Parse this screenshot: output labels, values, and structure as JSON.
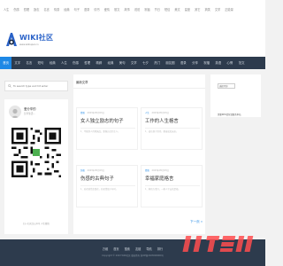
{
  "topbar": {
    "links": [
      "人生",
      "伤感",
      "哲理",
      "励志",
      "名言",
      "情感",
      "经典",
      "句子",
      "语录",
      "情书",
      "爱情",
      "散文",
      "故事",
      "说说",
      "祝福",
      "节日",
      "短信",
      "美文",
      "星座",
      "其它",
      "搞笑",
      "文学",
      "正能量"
    ]
  },
  "brand": {
    "logo_text": "WIKI社区",
    "tagline": "www.wikiuper.cn",
    "accent_color": "#2a62c8"
  },
  "nav": {
    "items": [
      "首页",
      "文字",
      "名言",
      "短句",
      "经典",
      "人生",
      "伤感",
      "哲理",
      "精辟",
      "经典",
      "美句",
      "文学",
      "七夕",
      "热门",
      "朋友圈",
      "语录",
      "分享",
      "祝福",
      "英语",
      "心情",
      "范文"
    ],
    "active_index": 0,
    "active_color": "#1e88e5",
    "bg_color": "#2d3b4d"
  },
  "search": {
    "placeholder": "To search type and hit enter"
  },
  "profile": {
    "name": "爱分享的",
    "bio": "分享生活...",
    "qr_caption": "扫一扫关注公众号 人生感悟"
  },
  "main": {
    "section_title": "最新文章",
    "cards": [
      {
        "category": "情感",
        "date": "2023年05月03日",
        "title": "女人独立励志的句子",
        "excerpt": "1、不做别人的附属品，要做自己的主人。"
      },
      {
        "category": "人生",
        "date": "2023年05月03日",
        "title": "工作的人生格言",
        "excerpt": "1、成功源于坚持，勤奋成就未来。"
      },
      {
        "category": "伤感",
        "date": "2023年05月03日",
        "title": "伤感的古典句子",
        "excerpt": "1、劝君莫惜金缕衣，劝君惜取少年时。"
      },
      {
        "category": "情感",
        "date": "2023年05月03日",
        "title": "幸福家庭格言",
        "excerpt": "1、家和万事兴，一家人平安就是福。"
      }
    ],
    "next_label": "下一页 »"
  },
  "sidebar": {
    "select_value": "选择月份",
    "text": "需要SEO优化请联系本站"
  },
  "footer": {
    "links": [
      "万维",
      "首页",
      "搜索",
      "友链",
      "导航",
      "排行"
    ],
    "copyright": "Copyright © 2023 WIKI社区 版权所有 浙ICP备2023000000号"
  }
}
